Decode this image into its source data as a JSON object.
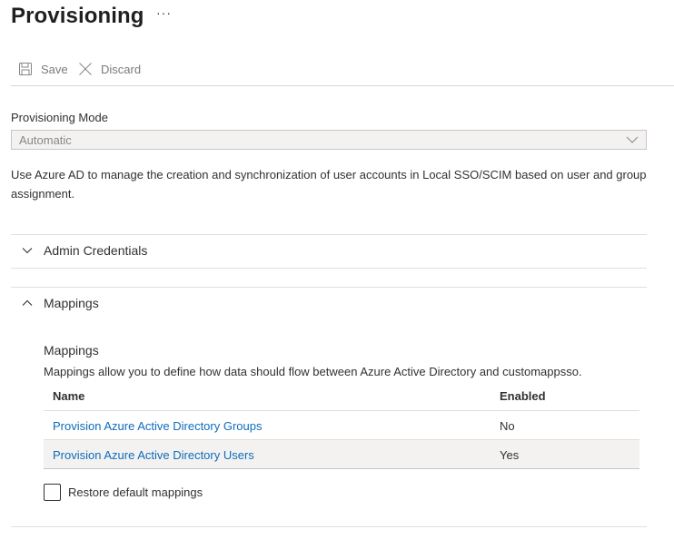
{
  "page": {
    "title": "Provisioning",
    "more_glyph": "···"
  },
  "toolbar": {
    "save_label": "Save",
    "discard_label": "Discard"
  },
  "provisioning_mode": {
    "label": "Provisioning Mode",
    "value": "Automatic"
  },
  "description": "Use Azure AD to manage the creation and synchronization of user accounts in Local SSO/SCIM based on user and group assignment.",
  "sections": {
    "admin_credentials": {
      "label": "Admin Credentials",
      "expanded": false
    },
    "mappings": {
      "label": "Mappings",
      "expanded": true
    }
  },
  "mappings": {
    "title": "Mappings",
    "description": "Mappings allow you to define how data should flow between Azure Active Directory and customappsso.",
    "columns": [
      "Name",
      "Enabled"
    ],
    "rows": [
      {
        "name": "Provision Azure Active Directory Groups",
        "enabled": "No",
        "selected": false
      },
      {
        "name": "Provision Azure Active Directory Users",
        "enabled": "Yes",
        "selected": true
      }
    ],
    "restore_label": "Restore default mappings",
    "restore_checked": false
  },
  "icons": {
    "save": "save-icon",
    "discard": "close-icon",
    "more": "more-icon",
    "dropdown": "chevron-down-icon",
    "collapsed": "chevron-down-icon",
    "expanded": "chevron-up-icon"
  },
  "colors": {
    "link": "#0f6cbd",
    "disabled_text": "#8a8886",
    "divider": "#e1dfdd",
    "selected_row": "#f3f2f1"
  }
}
